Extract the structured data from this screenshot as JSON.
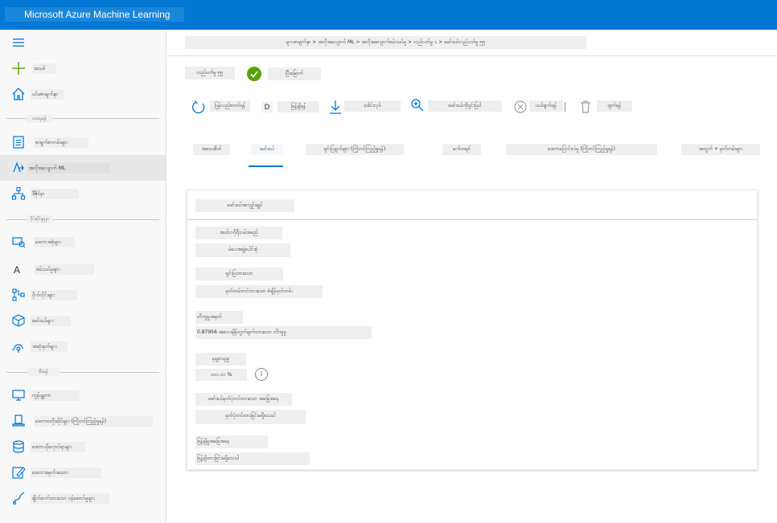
{
  "app": {
    "title": "Microsoft Azure Machine Learning"
  },
  "sidebar": {
    "menu_icon": "hamburger-icon",
    "items": [
      {
        "label": "အသစ်",
        "icon": "plus-icon"
      },
      {
        "label": "ပင်မစာမျက်နှာ",
        "icon": "home-icon"
      },
      {
        "label": "စာရွက်စာတမ်းများ",
        "icon": "notebook-icon"
      },
      {
        "label": "အလိုအလျောက် ML",
        "icon": "automl-icon"
      },
      {
        "label": "ဒီဇိုင်နာ",
        "icon": "designer-icon"
      },
      {
        "label": "ဒေတာအစုံများ",
        "icon": "datasets-icon"
      },
      {
        "label": "စမ်းသပ်မှုများ",
        "icon": "experiments-icon"
      },
      {
        "label": "ပိုက်လိုင်းများ",
        "icon": "pipelines-icon"
      },
      {
        "label": "မော်ဒယ်များ",
        "icon": "models-icon"
      },
      {
        "label": "အဆုံးမှတ်များ",
        "icon": "endpoints-icon"
      },
      {
        "label": "ကွန်ပျူတာ",
        "icon": "compute-icon"
      },
      {
        "label": "ဒေတာစတိုးဆိုင်များ (ကြိုတင်ကြည့်ရှုရန်)",
        "icon": "datastore-icon"
      },
      {
        "label": "ဒေတာသိုလှောင်ရာများ",
        "icon": "storage-icon"
      },
      {
        "label": "ဒေတာအမှတ်အသား",
        "icon": "labeling-icon"
      },
      {
        "label": "ချိတ်ဆက်ထားသော ဝန်ဆောင်မှုများ",
        "icon": "linked-services-icon"
      }
    ],
    "sections": [
      "စာရေးရန်",
      "ပိုင်ဆိုင်မှုများ",
      "စီမံရန်"
    ]
  },
  "breadcrumb": "မူလစာမျက်နှာ > အလိုအလျောက် ML > အလိုအလျောက်စမ်းသပ်မှု > လည်ပတ်မှု ၁ > မော်ဒယ်လည်ပတ်မှု ၅၅",
  "run": {
    "name": "လည်ပတ်မှု ၅၅",
    "status": "ပြီးမြောက်",
    "status_color": "#57a300"
  },
  "toolbar": {
    "refresh": "ပြန်လည်စတင်ရန်",
    "d_label": "D",
    "deploy": "ဖြန့်ချိရန်",
    "download": "ဒေါင်းလုဒ်",
    "explain": "မော်ဒယ်ကိုရှင်းပြပါ",
    "cancel": "ပယ်ဖျက်ရန်",
    "delete": "ဖျက်ရန်",
    "icons": [
      "refresh-icon",
      "download-icon",
      "explain-icon",
      "cancel-icon",
      "delete-icon"
    ]
  },
  "tabs": [
    "အသေးစိတ်",
    "မော်ဒယ်",
    "ရှင်းပြချက်များ (ကြိုတင်ကြည့်ရှုရန်)",
    "မက်ထရစ်",
    "ဒေတာပြောင်းလဲမှု (ကြိုတင်ကြည့်ရှုရန်)",
    "အထွက် + မှတ်တမ်းများ"
  ],
  "active_tab_index": 1,
  "card": {
    "title": "မော်ဒယ်အကျဉ်းချုပ်",
    "algorithm_label": "အယ်လဂိုရီသမ်အမည်",
    "algorithm_value": "မဲပေးအဖွဲ့ပေါင်းစုံ",
    "explained_label": "ရှင်းပြထားသော",
    "explained_value": "မှတ်တမ်းတင်ထားသော စံချိန်မှတ်တမ်း",
    "metric_label": "တိကျမှုအမှတ်",
    "metric_value": "0.87956 အလေးချိန်တွက်ချက်ထားသော တိကျမှု",
    "sampling_label": "နမူနာယူမှု",
    "sampling_value": "၁၀၀.၀၀ %",
    "info_button": "i",
    "regist_label": "မော်ဒယ်မှတ်ပုံတင်ထားသော အခြေအနေ",
    "regist_value": "မှတ်ပုံတင်ထားခြင်းမရှိသေးပါ",
    "deploy_label": "ဖြန့်ချိမှုအခြေအနေ",
    "deploy_value": "ဖြန့်ချိထားခြင်းမရှိသေးပါ"
  }
}
